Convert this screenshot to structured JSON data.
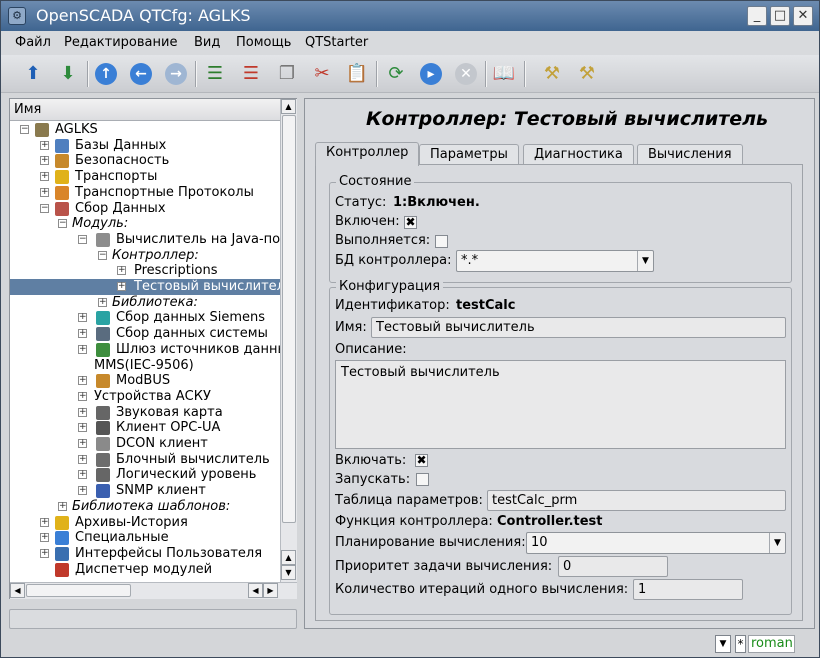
{
  "window": {
    "title": "OpenSCADA QTCfg: AGLKS",
    "app_icon": "openscada-logo-icon"
  },
  "window_buttons": [
    "_",
    "□",
    "✕"
  ],
  "menu": [
    "Файл",
    "Редактирование",
    "Вид",
    "Помощь",
    "QTStarter"
  ],
  "tree": {
    "header": "Имя",
    "items": [
      {
        "label": "AGLKS",
        "icon": "station-icon",
        "expander": "−"
      },
      {
        "label": "Базы Данных",
        "icon": "database-icon",
        "expander": "+"
      },
      {
        "label": "Безопасность",
        "icon": "users-icon",
        "expander": "+"
      },
      {
        "label": "Транспорты",
        "icon": "lightning-icon",
        "expander": "+"
      },
      {
        "label": "Транспортные Протоколы",
        "icon": "protocol-icon",
        "expander": "+"
      },
      {
        "label": "Сбор Данных",
        "icon": "chart-icon",
        "expander": "−"
      },
      {
        "label": "Модуль:",
        "icon": "",
        "expander": "−"
      },
      {
        "label": "Вычислитель на Java-по",
        "icon": "module-icon",
        "expander": "−"
      },
      {
        "label": "Контроллер:",
        "icon": "",
        "expander": "−"
      },
      {
        "label": "Prescriptions",
        "icon": "",
        "expander": "+"
      },
      {
        "label": "Тестовый вычислител",
        "icon": "",
        "expander": "+"
      },
      {
        "label": "Библиотека:",
        "icon": "",
        "expander": "+"
      },
      {
        "label": "Сбор данных Siemens",
        "icon": "siemens-icon",
        "expander": "+"
      },
      {
        "label": "Сбор данных системы",
        "icon": "computer-icon",
        "expander": "+"
      },
      {
        "label": "Шлюз источников данны",
        "icon": "gateway-icon",
        "expander": "+"
      },
      {
        "label": "MMS(IEC-9506)",
        "icon": "",
        "expander": ""
      },
      {
        "label": "ModBUS",
        "icon": "modbus-icon",
        "expander": "+"
      },
      {
        "label": "Устройства АСКУ",
        "icon": "",
        "expander": "+"
      },
      {
        "label": "Звуковая карта",
        "icon": "microphone-icon",
        "expander": "+"
      },
      {
        "label": "Клиент OPC-UA",
        "icon": "opcua-icon",
        "expander": "+"
      },
      {
        "label": "DCON клиент",
        "icon": "dcon-icon",
        "expander": "+"
      },
      {
        "label": "Блочный вычислитель",
        "icon": "cube-icon",
        "expander": "+"
      },
      {
        "label": "Логический уровень",
        "icon": "logic-icon",
        "expander": "+"
      },
      {
        "label": "SNMP клиент",
        "icon": "snmp-icon",
        "expander": "+"
      },
      {
        "label": "Библиотека шаблонов:",
        "icon": "",
        "expander": "+"
      },
      {
        "label": "Архивы-История",
        "icon": "archive-icon",
        "expander": "+"
      },
      {
        "label": "Специальные",
        "icon": "special-icon",
        "expander": "+"
      },
      {
        "label": "Интерфейсы Пользователя",
        "icon": "monitor-icon",
        "expander": "+"
      },
      {
        "label": "Диспетчер модулей",
        "icon": "modules-icon",
        "expander": ""
      }
    ]
  },
  "main": {
    "title": "Контроллер: Тестовый вычислитель",
    "tabs": [
      "Контроллер",
      "Параметры",
      "Диагностика",
      "Вычисления"
    ],
    "state": {
      "legend": "Состояние",
      "status_label": "Статус:",
      "status_value": "1:Включен.",
      "enabled_label": "Включен:",
      "enabled": true,
      "running_label": "Выполняется:",
      "running": false,
      "db_label": "БД контроллера:",
      "db_value": "*.*"
    },
    "config": {
      "legend": "Конфигурация",
      "id_label": "Идентификатор:",
      "id_value": "testCalc",
      "name_label": "Имя:",
      "name_value": "Тестовый вычислитель",
      "descr_label": "Описание:",
      "descr_value": "Тестовый вычислитель",
      "enable_label": "Включать:",
      "enable": true,
      "start_label": "Запускать:",
      "start": false,
      "table_label": "Таблица параметров:",
      "table_value": "testCalc_prm",
      "func_label": "Функция контроллера:",
      "func_value": "Controller.test",
      "schedule_label": "Планирование вычисления:",
      "schedule_value": "10",
      "priority_label": "Приоритет задачи вычисления:",
      "priority_value": "0",
      "iter_label": "Количество итераций одного вычисления:",
      "iter_value": "1"
    }
  },
  "statusbar": {
    "user": "roman",
    "marker": "*"
  }
}
